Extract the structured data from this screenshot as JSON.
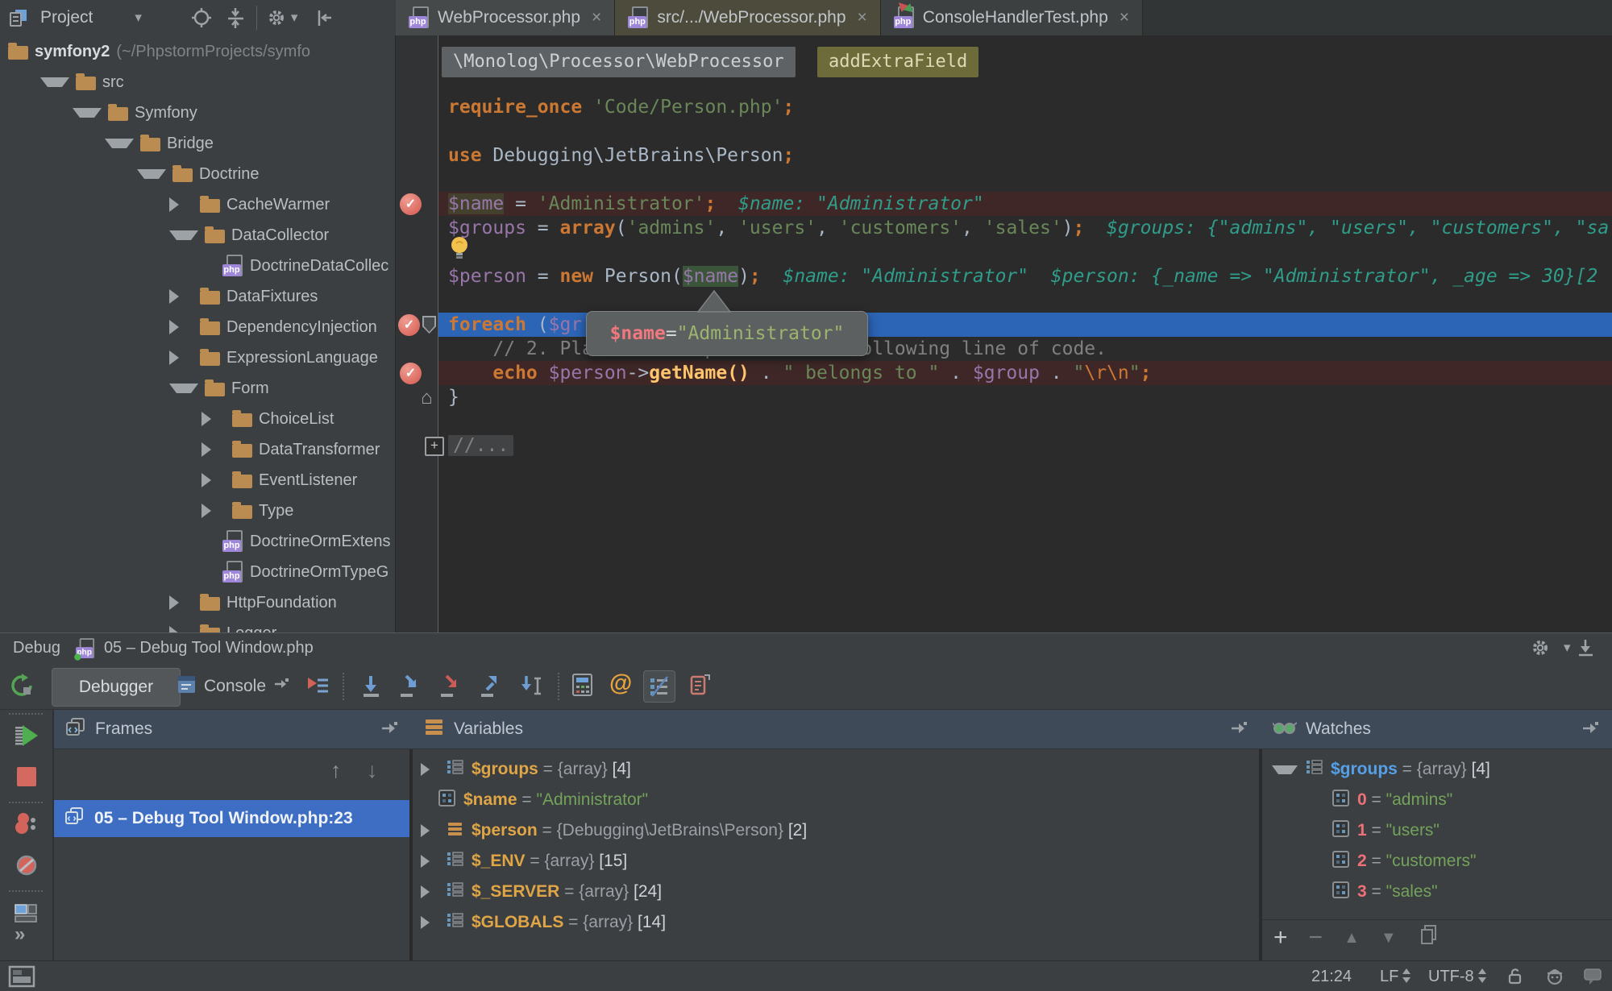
{
  "glyphs": {
    "caret": "▾",
    "close": "×",
    "more": "»",
    "up": "↑",
    "down": "↓",
    "at": "@",
    "plus": "+",
    "minus": "−",
    "tri_up": "▲",
    "tri_down": "▼",
    "house": "⌂",
    "check": "✓",
    "php": "php"
  },
  "colors": {
    "keyword_orange": "#cc7832",
    "string_green": "#6a8759",
    "variable_purple": "#9876aa",
    "inline_value_teal": "#2f9d8a",
    "breakpoint_line": "#3f2727",
    "execution_line": "#2c65b5",
    "selection_blue": "#3d6ec3",
    "tab_selected_olive": "#4d4b3b",
    "folder_tan": "#ba8c52",
    "php_badge_purple": "#9e87d8",
    "breakpoint_red": "#db5c5c",
    "watch_name_blue": "#55a0e8",
    "variable_name_amber": "#dfa546",
    "index_pink": "#ee7078",
    "value_green": "#73a25b"
  },
  "topbar": {
    "project": "Project",
    "tabs": [
      {
        "label": "WebProcessor.php"
      },
      {
        "label": "src/.../WebProcessor.php"
      },
      {
        "label": "ConsoleHandlerTest.php"
      }
    ]
  },
  "breadcrumb": {
    "class_name": "\\Monolog\\Processor\\WebProcessor",
    "method_name": "addExtraField"
  },
  "tree": {
    "root": {
      "name": "symfony2",
      "path": "(~/PhpstormProjects/symfo"
    },
    "items": [
      "src",
      "Symfony",
      "Bridge",
      "Doctrine",
      "CacheWarmer",
      "DataCollector",
      "DoctrineDataCollec",
      "DataFixtures",
      "DependencyInjection",
      "ExpressionLanguage",
      "Form",
      "ChoiceList",
      "DataTransformer",
      "EventListener",
      "Type",
      "DoctrineOrmExtens",
      "DoctrineOrmTypeG",
      "HttpFoundation",
      "Logger"
    ]
  },
  "code": {
    "line_require": {
      "kw": "require_once ",
      "str": "'Code/Person.php'",
      "end": ";"
    },
    "line_use": {
      "kw": "use ",
      "pl": "Debugging\\JetBrains\\Person",
      "end": ";"
    },
    "line_name": {
      "v": "$name",
      "op": " = ",
      "str": "'Administrator'",
      "end": ";",
      "inline": "  $name: \"Administrator\""
    },
    "line_groups": {
      "v": "$groups",
      "op": " = ",
      "kw": "array",
      "p1": "(",
      "s1": "'admins'",
      "c1": ", ",
      "s2": "'users'",
      "c2": ", ",
      "s3": "'customers'",
      "c3": ", ",
      "s4": "'sales'",
      "p2": ")",
      "end": ";",
      "inline": "  $groups: {\"admins\", \"users\", \"customers\", \"sa"
    },
    "line_person": {
      "v": "$person",
      "op": " = ",
      "kw": "new ",
      "cls": "Person(",
      "arg": "$name",
      "p2": ")",
      "end": ";",
      "inline": "  $name: \"Administrator\"  $person: {_name => \"Administrator\", _age => 30}[2"
    },
    "line_foreach": {
      "kw": "foreach",
      "op": " (",
      "v": "$gr"
    },
    "line_comment": {
      "cm": "    // 2. Place a breakpoint on the following line of code."
    },
    "line_echo": {
      "kw": "    echo ",
      "v1": "$person",
      "op1": "->",
      "fn": "getName()",
      "d1": " . ",
      "s1": "\" belongs to \"",
      "d2": " . ",
      "v2": "$group",
      "d3": " . ",
      "q1": "\"",
      "esc": "\\r\\n",
      "q2": "\"",
      "end": ";"
    },
    "line_brace": {
      "pl": "}"
    },
    "line_fold": {
      "cm": "//..."
    },
    "tooltip": {
      "name": "$name",
      "eq": " = ",
      "value": "\"Administrator\""
    }
  },
  "debug": {
    "window_label": "Debug",
    "window_title": "05 – Debug Tool Window.php",
    "tab_debugger": "Debugger",
    "tab_console": "Console",
    "frames": {
      "title": "Frames",
      "frame": "05 – Debug Tool Window.php:23"
    },
    "variables": {
      "title": "Variables",
      "rows": [
        {
          "name": "$groups",
          "eq": " = ",
          "type": "{array} ",
          "count": "[4]"
        },
        {
          "name": "$name",
          "eq": " = ",
          "value": "\"Administrator\""
        },
        {
          "name": "$person",
          "eq": " = ",
          "type": "{Debugging\\JetBrains\\Person} ",
          "count": "[2]"
        },
        {
          "name": "$_ENV",
          "eq": " = ",
          "type": "{array} ",
          "count": "[15]"
        },
        {
          "name": "$_SERVER",
          "eq": " = ",
          "type": "{array} ",
          "count": "[24]"
        },
        {
          "name": "$GLOBALS",
          "eq": " = ",
          "type": "{array} ",
          "count": "[14]"
        }
      ]
    },
    "watches": {
      "title": "Watches",
      "root": {
        "name": "$groups",
        "eq": " = ",
        "type": "{array} ",
        "count": "[4]"
      },
      "items": [
        {
          "index": "0",
          "eq": " = ",
          "value": "\"admins\""
        },
        {
          "index": "1",
          "eq": " = ",
          "value": "\"users\""
        },
        {
          "index": "2",
          "eq": " = ",
          "value": "\"customers\""
        },
        {
          "index": "3",
          "eq": " = ",
          "value": "\"sales\""
        }
      ]
    }
  },
  "status": {
    "caret_position": "21:24",
    "line_separator": "LF",
    "encoding": "UTF-8"
  }
}
